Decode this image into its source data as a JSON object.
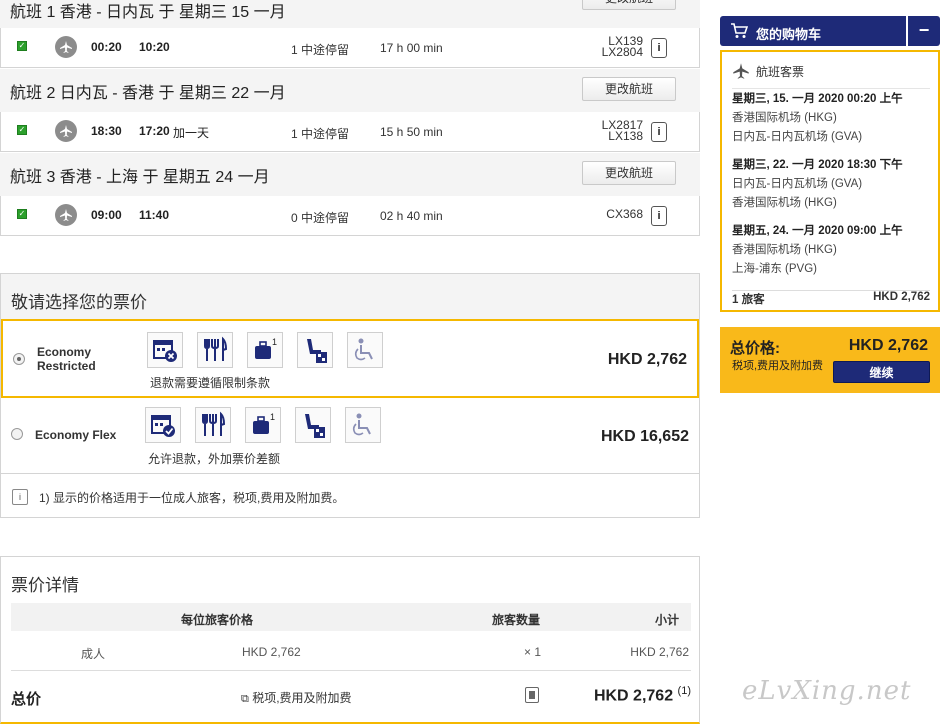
{
  "flights": [
    {
      "title": "航班 1 香港 - 日内瓦 于 星期三 15 一月",
      "change_label": "更改航班",
      "dep": "00:20",
      "arr": "10:20",
      "plus_day": "",
      "stops": "1 中途停留",
      "duration": "17 h 00 min",
      "flight_no_1": "LX139",
      "flight_no_2": "LX2804"
    },
    {
      "title": "航班 2 日内瓦 - 香港 于 星期三 22 一月",
      "change_label": "更改航班",
      "dep": "18:30",
      "arr": "17:20",
      "plus_day": "加一天",
      "stops": "1 中途停留",
      "duration": "15 h 50 min",
      "flight_no_1": "LX2817",
      "flight_no_2": "LX138"
    },
    {
      "title": "航班 3 香港 - 上海 于 星期五 24 一月",
      "change_label": "更改航班",
      "dep": "09:00",
      "arr": "11:40",
      "plus_day": "",
      "stops": "0 中途停留",
      "duration": "02 h 40 min",
      "flight_no_1": "CX368",
      "flight_no_2": ""
    }
  ],
  "info_glyph": "i",
  "fare": {
    "title": "敬请选择您的票价",
    "options": [
      {
        "name_line1": "Economy",
        "name_line2": "Restricted",
        "note": "退款需要遵循限制条款",
        "price": "HKD 2,762",
        "selected": true
      },
      {
        "name_line1": "Economy Flex",
        "name_line2": "",
        "note": "允许退款，外加票价差额",
        "price": "HKD 16,652",
        "selected": false
      }
    ],
    "baggage_count": "1",
    "footnote": "1) 显示的价格适用于一位成人旅客，税项,费用及附加费。"
  },
  "details": {
    "title": "票价详情",
    "col_price": "每位旅客价格",
    "col_qty": "旅客数量",
    "col_subtotal": "小计",
    "row_type": "成人",
    "row_price": "HKD 2,762",
    "row_qty": "× 1",
    "row_subtotal": "HKD 2,762",
    "total_label": "总价",
    "tax_label": "税项,费用及附加费",
    "total_amount": "HKD 2,762",
    "total_sup": "(1)"
  },
  "cart": {
    "button_label": "您的购物车",
    "collapse_label": "−",
    "panel_title": "航班客票",
    "segments": [
      {
        "date": "星期三, 15. 一月 2020 00:20 上午",
        "from": "香港国际机场 (HKG)",
        "to": "日内瓦-日内瓦机场 (GVA)"
      },
      {
        "date": "星期三, 22. 一月 2020 18:30 下午",
        "from": "日内瓦-日内瓦机场 (GVA)",
        "to": "香港国际机场 (HKG)"
      },
      {
        "date": "星期五, 24. 一月 2020 09:00 上午",
        "from": "香港国际机场 (HKG)",
        "to": "上海-浦东 (PVG)"
      }
    ],
    "pax_label": "1 旅客",
    "pax_amount": "HKD 2,762"
  },
  "total_box": {
    "label": "总价格:",
    "amount": "HKD 2,762",
    "sub": "税项,费用及附加费",
    "continue_label": "继续"
  },
  "watermark": "eLvXing.net",
  "colors": {
    "accent": "#f5b800",
    "brand": "#1e2a78",
    "check": "#2ca02c"
  }
}
